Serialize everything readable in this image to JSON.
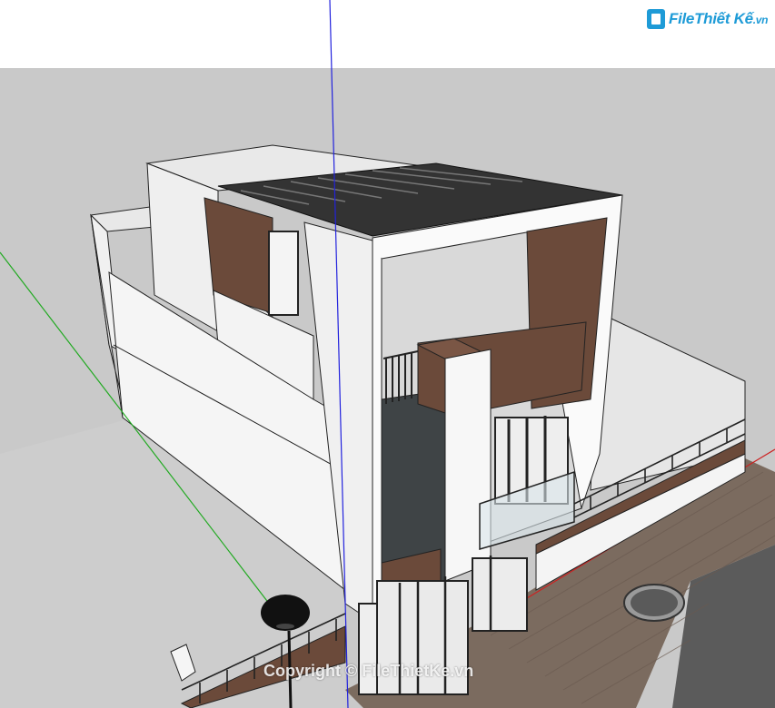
{
  "logo": {
    "brand": "File",
    "name": "Thiết Kế",
    "suffix": ".vn"
  },
  "watermark": {
    "text": "Copyright © FileThietKe.vn"
  },
  "colors": {
    "sky": "#ffffff",
    "ground": "#c8c8c8",
    "wall_white": "#f2f2f2",
    "wall_shade": "#dcdcdc",
    "wood": "#6b4a3a",
    "roof_dark": "#2f2f2f",
    "pavement": "#7a6a5e",
    "road": "#5a5a5a",
    "axis_blue": "#2222dd",
    "axis_green": "#22aa22",
    "axis_red": "#cc2222"
  },
  "icons": [
    "street-lamp-icon",
    "manhole-icon",
    "logo-icon"
  ]
}
